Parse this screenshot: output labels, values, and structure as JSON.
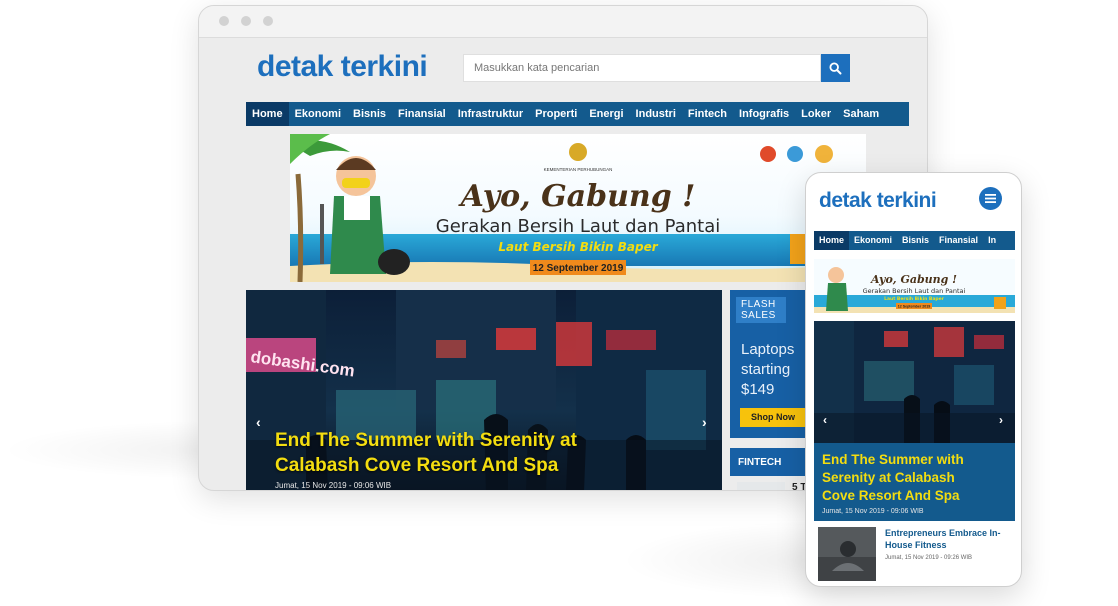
{
  "brand": {
    "name": "detak terkini",
    "accent": "#1d6fbd",
    "nav_color": "#135a8d",
    "headline_color": "#f3dd10"
  },
  "search": {
    "placeholder": "Masukkan kata pencarian"
  },
  "nav": {
    "items": [
      "Home",
      "Ekonomi",
      "Bisnis",
      "Finansial",
      "Infrastruktur",
      "Properti",
      "Energi",
      "Industri",
      "Fintech",
      "Infografis",
      "Loker",
      "Saham"
    ]
  },
  "banner": {
    "org": "KEMENTERIAN PERHUBUNGAN",
    "headline": "Ayo, Gabung !",
    "subtitle": "Gerakan Bersih Laut dan Pantai",
    "tagline": "Laut Bersih Bikin Baper",
    "date": "12 September 2019"
  },
  "hero": {
    "sign_text": "dobashi.com",
    "title": "End The Summer with Serenity at Calabash Cove Resort And Spa",
    "title_line1": "End The Summer with Serenity at",
    "title_line2": "Calabash Cove Resort And Spa",
    "date": "Jumat, 15 Nov 2019 - 09:06 WIB",
    "prev_icon": "chevron-left-icon",
    "next_icon": "chevron-right-icon"
  },
  "flash_sale": {
    "tag_line1": "FLASH",
    "tag_line2": "SALES",
    "line1": "Laptops",
    "line2": "starting",
    "line3": "$149",
    "button": "Shop Now"
  },
  "fintech": {
    "label": "FINTECH",
    "preview": "5 T"
  },
  "mobile": {
    "nav_items": [
      "Home",
      "Ekonomi",
      "Bisnis",
      "Finansial",
      "In"
    ],
    "hero_line1": "End The Summer with",
    "hero_line2": "Serenity at Calabash",
    "hero_line3": "Cove Resort And Spa",
    "hero_date": "Jumat, 15 Nov 2019 - 09:06 WIB",
    "article": {
      "title": "Entrepreneurs Embrace In-House Fitness",
      "date": "Jumat, 15 Nov 2019 - 09:26 WIB"
    }
  }
}
